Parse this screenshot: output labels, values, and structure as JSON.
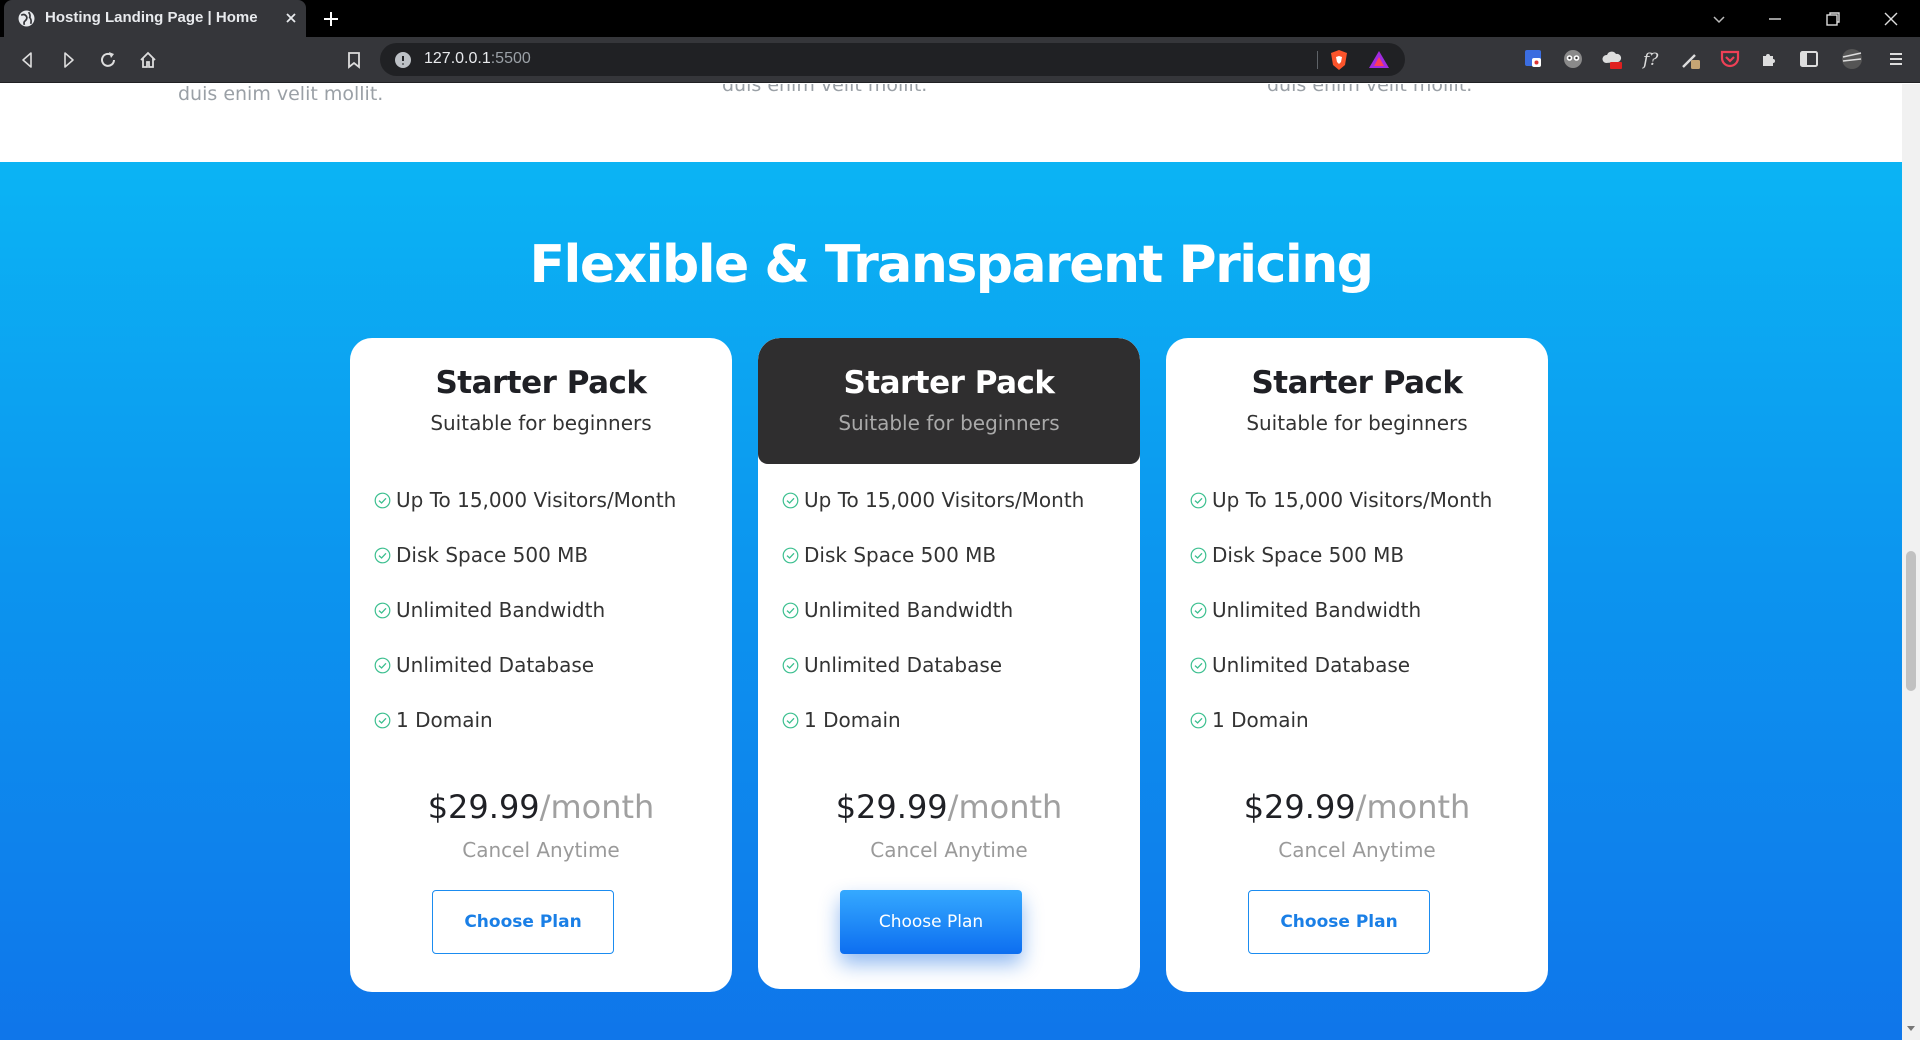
{
  "browser": {
    "tab_title": "Hosting Landing Page | Home",
    "url_host": "127.0.0.1",
    "url_port": ":5500"
  },
  "page": {
    "feature_tails": [
      "duis enim velit mollit.",
      "duis enim velit mollit.",
      "duis enim velit mollit."
    ],
    "pricing_title": "Flexible & Transparent Pricing",
    "plans": [
      {
        "name": "Starter Pack",
        "subtitle": "Suitable for beginners",
        "features": [
          "Up To 15,000 Visitors/Month",
          "Disk Space 500 MB",
          "Unlimited Bandwidth",
          "Unlimited Database",
          "1 Domain"
        ],
        "price": "$29.99",
        "period": "/month",
        "cancel_note": "Cancel Anytime",
        "button_label": "Choose Plan"
      },
      {
        "name": "Starter Pack",
        "subtitle": "Suitable for beginners",
        "features": [
          "Up To 15,000 Visitors/Month",
          "Disk Space 500 MB",
          "Unlimited Bandwidth",
          "Unlimited Database",
          "1 Domain"
        ],
        "price": "$29.99",
        "period": "/month",
        "cancel_note": "Cancel Anytime",
        "button_label": "Choose Plan"
      },
      {
        "name": "Starter Pack",
        "subtitle": "Suitable for beginners",
        "features": [
          "Up To 15,000 Visitors/Month",
          "Disk Space 500 MB",
          "Unlimited Bandwidth",
          "Unlimited Database",
          "1 Domain"
        ],
        "price": "$29.99",
        "period": "/month",
        "cancel_note": "Cancel Anytime",
        "button_label": "Choose Plan"
      }
    ]
  },
  "colors": {
    "gradient_top": "#0bb4f4",
    "gradient_bottom": "#0f74ea",
    "featured_header": "#2f2e2f",
    "accent_blue": "#1a7fe6",
    "check_green": "#3bbf8f"
  }
}
